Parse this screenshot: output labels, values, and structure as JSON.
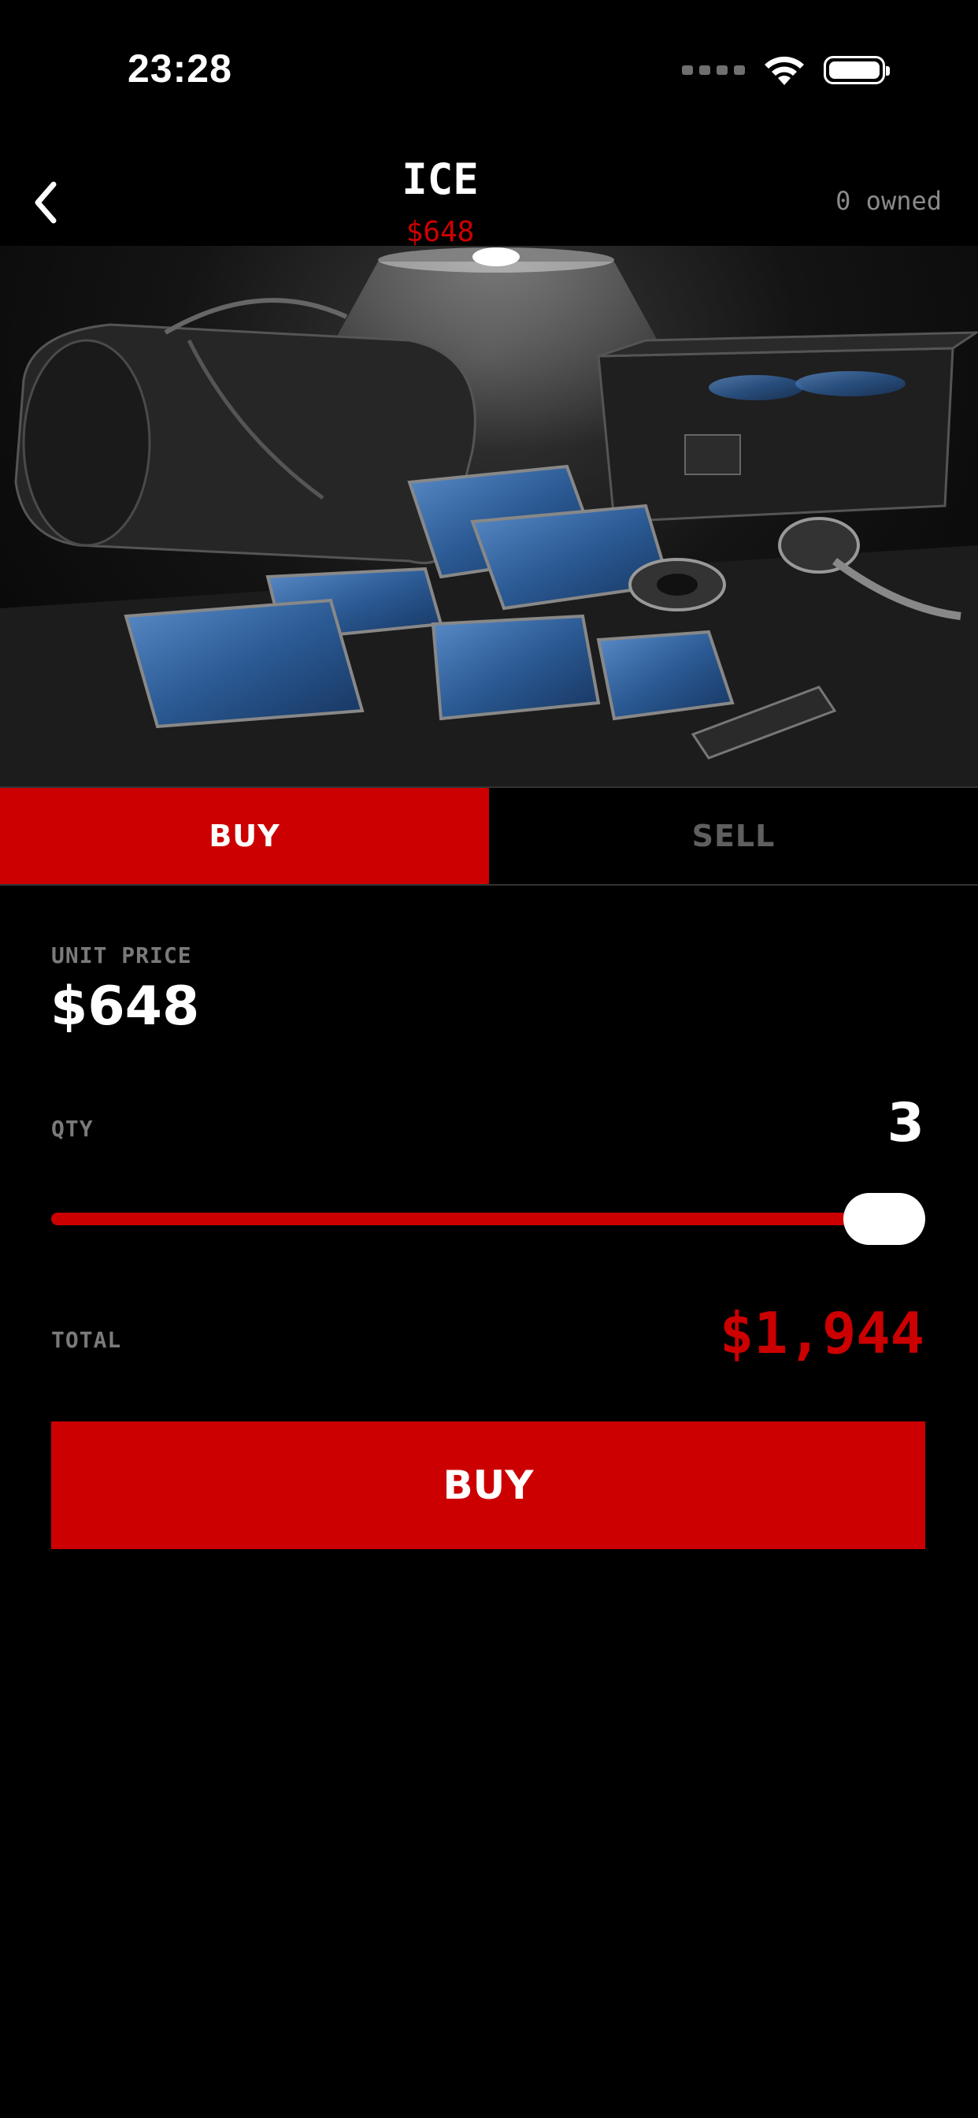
{
  "status_bar": {
    "time": "23:28",
    "signal": "cell-signal-icon",
    "wifi": "wifi-icon",
    "battery": "battery-icon"
  },
  "header": {
    "back_icon": "chevron-left-icon",
    "title": "ICE",
    "price": "$648",
    "owned": "0 owned"
  },
  "tabs": [
    {
      "label": "BUY",
      "active": true
    },
    {
      "label": "SELL",
      "active": false
    }
  ],
  "trade": {
    "unit_price_label": "UNIT PRICE",
    "unit_price": "$648",
    "qty_label": "QTY",
    "qty": "3",
    "slider_fraction": 1.0,
    "total_label": "TOTAL",
    "total": "$1,944",
    "buy_button_label": "BUY"
  },
  "colors": {
    "accent": "#cc0000",
    "background": "#000000",
    "muted_text": "#7a7a7a"
  }
}
